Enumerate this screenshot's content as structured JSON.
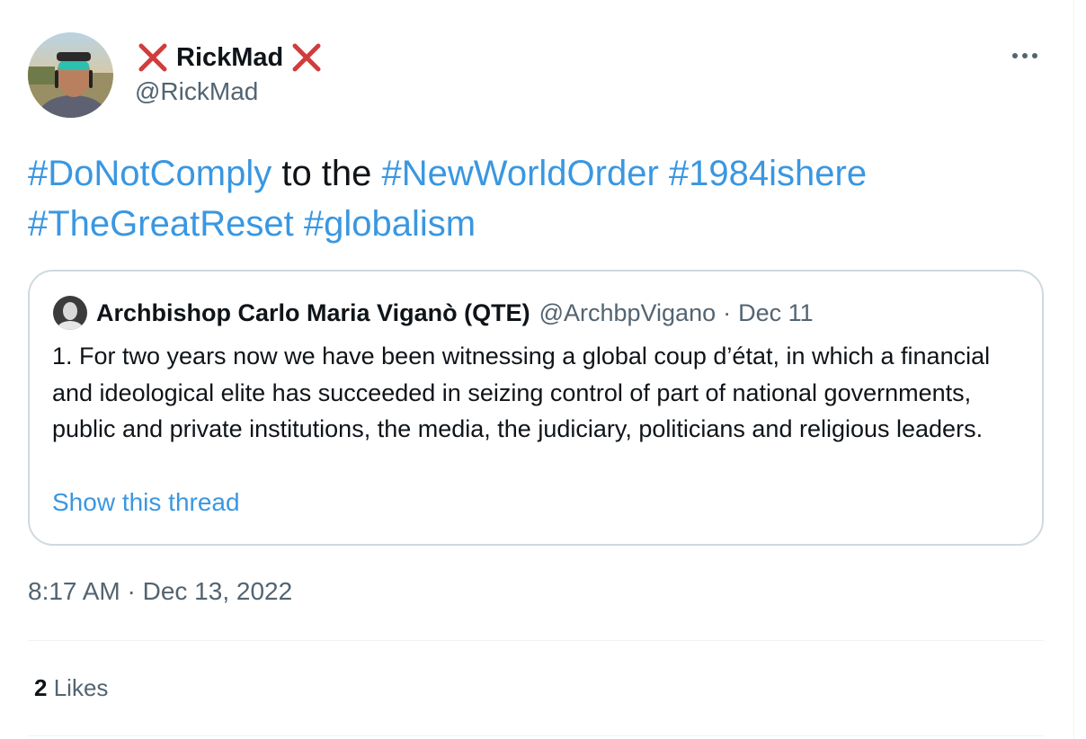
{
  "author": {
    "display_name": "RickMad",
    "handle": "@RickMad",
    "name_decoration_icon": "cross-mark-icon",
    "avatar_icon": "user-photo-avatar"
  },
  "menu": {
    "more_icon": "more-dots-icon"
  },
  "tweet": {
    "segments": [
      {
        "text": "#DoNotComply",
        "type": "hashtag"
      },
      {
        "text": " to the ",
        "type": "text"
      },
      {
        "text": "#NewWorldOrder",
        "type": "hashtag"
      },
      {
        "text": " ",
        "type": "text"
      },
      {
        "text": "#1984ishere",
        "type": "hashtag"
      },
      {
        "text": " ",
        "type": "text"
      },
      {
        "text": "#TheGreatReset",
        "type": "hashtag"
      },
      {
        "text": " ",
        "type": "text"
      },
      {
        "text": "#globalism",
        "type": "hashtag"
      }
    ],
    "timestamp": "8:17 AM · Dec 13, 2022"
  },
  "quoted_tweet": {
    "author_name": "Archbishop Carlo Maria Viganò (QTE)",
    "handle": "@ArchbpVigano",
    "separator": "·",
    "date": "Dec 11",
    "text": "1. For two years now we have been witnessing a global coup d’état, in which a financial and ideological elite has succeeded in seizing control of part of national governments, public and private institutions, the media, the judiciary, politicians and religious leaders.",
    "show_thread_label": "Show this thread"
  },
  "engagement": {
    "likes_count": "2",
    "likes_label": "Likes"
  },
  "colors": {
    "link": "#3a97e1",
    "text": "#0f1419",
    "secondary": "#536471",
    "border": "#cfd9de",
    "cross_mark": "#d13c3c"
  }
}
